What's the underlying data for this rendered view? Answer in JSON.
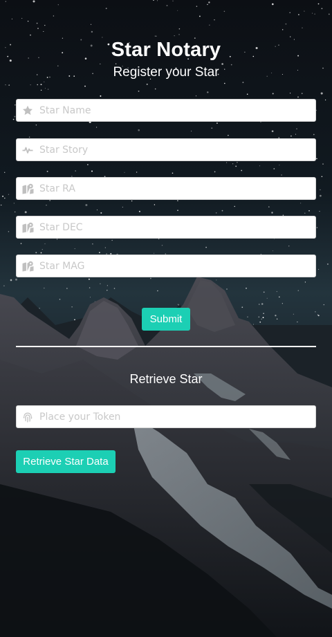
{
  "header": {
    "title": "Star Notary",
    "subtitle": "Register your Star"
  },
  "register_form": {
    "fields": [
      {
        "placeholder": "Star Name",
        "icon": "star-icon",
        "value": ""
      },
      {
        "placeholder": "Star Story",
        "icon": "heartbeat-icon",
        "value": ""
      },
      {
        "placeholder": "Star RA",
        "icon": "map-location-icon",
        "value": ""
      },
      {
        "placeholder": "Star DEC",
        "icon": "map-location-icon",
        "value": ""
      },
      {
        "placeholder": "Star MAG",
        "icon": "map-location-icon",
        "value": ""
      }
    ],
    "submit_label": "Submit"
  },
  "retrieve_section": {
    "title": "Retrieve Star",
    "token_field": {
      "placeholder": "Place your Token",
      "icon": "fingerprint-icon",
      "value": ""
    },
    "button_label": "Retrieve Star Data"
  },
  "colors": {
    "accent": "#1ccfb4",
    "icon": "#c0c0c0",
    "text_light": "#ffffff"
  }
}
